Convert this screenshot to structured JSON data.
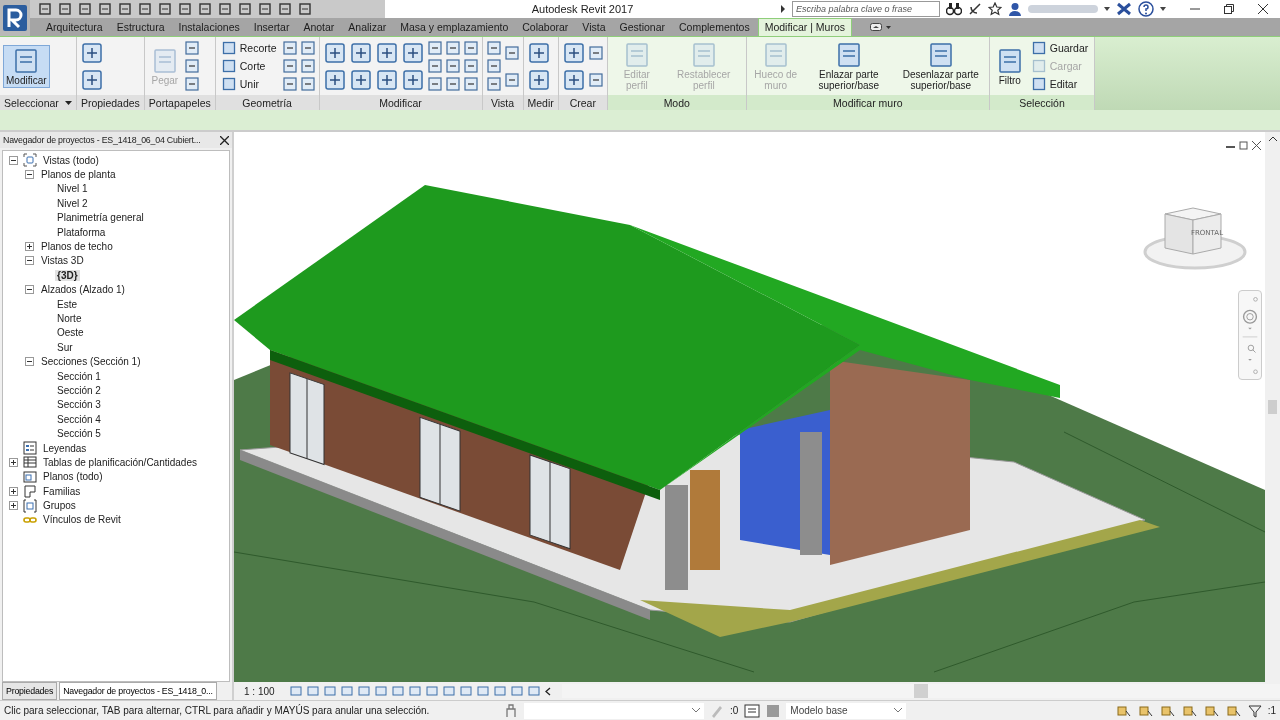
{
  "window": {
    "title": "Autodesk Revit 2017"
  },
  "search": {
    "placeholder": "Escriba palabra clave o frase"
  },
  "ribbon_tabs": [
    {
      "label": "Arquitectura",
      "selected": false
    },
    {
      "label": "Estructura",
      "selected": false
    },
    {
      "label": "Instalaciones",
      "selected": false
    },
    {
      "label": "Insertar",
      "selected": false
    },
    {
      "label": "Anotar",
      "selected": false
    },
    {
      "label": "Analizar",
      "selected": false
    },
    {
      "label": "Masa y emplazamiento",
      "selected": false
    },
    {
      "label": "Colaborar",
      "selected": false
    },
    {
      "label": "Vista",
      "selected": false
    },
    {
      "label": "Gestionar",
      "selected": false
    },
    {
      "label": "Complementos",
      "selected": false
    },
    {
      "label": "Modificar | Muros",
      "selected": true
    }
  ],
  "ribbon_panels": [
    {
      "label": "Seleccionar",
      "dropdown": true,
      "contextual": false,
      "columns": [
        [
          {
            "kind": "large",
            "label": "Modificar",
            "active": true,
            "disabled": false
          }
        ]
      ]
    },
    {
      "label": "Propiedades",
      "dropdown": false,
      "contextual": false,
      "columns": [
        [
          {
            "kind": "bigicon"
          },
          {
            "kind": "bigicon"
          }
        ]
      ]
    },
    {
      "label": "Portapapeles",
      "dropdown": false,
      "contextual": false,
      "columns": [
        [
          {
            "kind": "large",
            "label": "Pegar",
            "active": false,
            "disabled": true
          }
        ],
        [
          {
            "kind": "icon"
          },
          {
            "kind": "icon"
          },
          {
            "kind": "icon"
          }
        ]
      ]
    },
    {
      "label": "Geometría",
      "dropdown": false,
      "contextual": false,
      "columns": [
        [
          {
            "kind": "small",
            "label": "Recorte",
            "active": false,
            "disabled": false
          },
          {
            "kind": "small",
            "label": "Corte",
            "active": false,
            "disabled": false
          },
          {
            "kind": "small",
            "label": "Unir",
            "active": false,
            "disabled": false
          }
        ],
        [
          {
            "kind": "icon"
          },
          {
            "kind": "icon"
          },
          {
            "kind": "icon"
          }
        ],
        [
          {
            "kind": "icon"
          },
          {
            "kind": "icon"
          },
          {
            "kind": "icon"
          }
        ]
      ]
    },
    {
      "label": "Modificar",
      "dropdown": false,
      "contextual": false,
      "columns": [
        [
          {
            "kind": "bigicon"
          },
          {
            "kind": "bigicon"
          }
        ],
        [
          {
            "kind": "bigicon"
          },
          {
            "kind": "bigicon"
          }
        ],
        [
          {
            "kind": "bigicon"
          },
          {
            "kind": "bigicon"
          }
        ],
        [
          {
            "kind": "bigicon"
          },
          {
            "kind": "bigicon"
          }
        ],
        [
          {
            "kind": "icon"
          },
          {
            "kind": "icon"
          },
          {
            "kind": "icon"
          }
        ],
        [
          {
            "kind": "icon"
          },
          {
            "kind": "icon"
          },
          {
            "kind": "icon"
          }
        ],
        [
          {
            "kind": "icon"
          },
          {
            "kind": "icon"
          },
          {
            "kind": "icon"
          }
        ]
      ]
    },
    {
      "label": "Vista",
      "dropdown": false,
      "contextual": false,
      "columns": [
        [
          {
            "kind": "icon"
          },
          {
            "kind": "icon"
          },
          {
            "kind": "icon"
          }
        ],
        [
          {
            "kind": "icon"
          },
          {
            "kind": "icon"
          }
        ]
      ]
    },
    {
      "label": "Medir",
      "dropdown": false,
      "contextual": false,
      "columns": [
        [
          {
            "kind": "bigicon"
          },
          {
            "kind": "bigicon"
          }
        ]
      ]
    },
    {
      "label": "Crear",
      "dropdown": false,
      "contextual": false,
      "columns": [
        [
          {
            "kind": "bigicon"
          },
          {
            "kind": "bigicon"
          }
        ],
        [
          {
            "kind": "icon"
          },
          {
            "kind": "icon"
          }
        ]
      ]
    },
    {
      "label": "Modo",
      "dropdown": false,
      "contextual": true,
      "columns": [
        [
          {
            "kind": "large",
            "label": "Editar perfil",
            "active": false,
            "disabled": true
          }
        ],
        [
          {
            "kind": "large",
            "label": "Restablecer perfil",
            "active": false,
            "disabled": true
          }
        ]
      ]
    },
    {
      "label": "Modificar muro",
      "dropdown": false,
      "contextual": true,
      "columns": [
        [
          {
            "kind": "large",
            "label": "Hueco de muro",
            "active": false,
            "disabled": true
          }
        ],
        [
          {
            "kind": "large",
            "label": "Enlazar parte superior/base",
            "active": false,
            "disabled": false
          }
        ],
        [
          {
            "kind": "large",
            "label": "Desenlazar parte superior/base",
            "active": false,
            "disabled": false
          }
        ]
      ]
    },
    {
      "label": "Selección",
      "dropdown": false,
      "contextual": true,
      "columns": [
        [
          {
            "kind": "large",
            "label": "Filtro",
            "active": false,
            "disabled": false
          }
        ],
        [
          {
            "kind": "small",
            "label": "Guardar",
            "active": false,
            "disabled": false
          },
          {
            "kind": "small",
            "label": "Cargar",
            "active": false,
            "disabled": true
          },
          {
            "kind": "small",
            "label": "Editar",
            "active": false,
            "disabled": false
          }
        ]
      ]
    }
  ],
  "project_browser": {
    "title": "Navegador de proyectos - ES_1418_06_04 Cubiert...",
    "tree": [
      {
        "kind": "views",
        "label": "Vistas (todo)",
        "expanded": true,
        "selected": false,
        "children": [
          {
            "label": "Planos de planta",
            "expanded": true,
            "selected": false,
            "children": [
              {
                "label": "Nivel 1",
                "selected": false
              },
              {
                "label": "Nivel 2",
                "selected": false
              },
              {
                "label": "Planimetría general",
                "selected": false
              },
              {
                "label": "Plataforma",
                "selected": false
              }
            ]
          },
          {
            "label": "Planos de techo",
            "expanded": false,
            "selected": false
          },
          {
            "label": "Vistas 3D",
            "expanded": true,
            "selected": false,
            "children": [
              {
                "label": "{3D}",
                "selected": true
              }
            ]
          },
          {
            "label": "Alzados (Alzado 1)",
            "expanded": true,
            "selected": false,
            "children": [
              {
                "label": "Este",
                "selected": false
              },
              {
                "label": "Norte",
                "selected": false
              },
              {
                "label": "Oeste",
                "selected": false
              },
              {
                "label": "Sur",
                "selected": false
              }
            ]
          },
          {
            "label": "Secciones (Sección 1)",
            "expanded": true,
            "selected": false,
            "children": [
              {
                "label": "Sección 1",
                "selected": false
              },
              {
                "label": "Sección 2",
                "selected": false
              },
              {
                "label": "Sección 3",
                "selected": false
              },
              {
                "label": "Sección 4",
                "selected": false
              },
              {
                "label": "Sección 5",
                "selected": false
              }
            ]
          }
        ]
      },
      {
        "kind": "legend",
        "label": "Leyendas",
        "selected": false
      },
      {
        "kind": "schedule",
        "label": "Tablas de planificación/Cantidades",
        "expanded": false,
        "selected": false
      },
      {
        "kind": "sheets",
        "label": "Planos (todo)",
        "selected": false
      },
      {
        "kind": "families",
        "label": "Familias",
        "expanded": false,
        "selected": false
      },
      {
        "kind": "groups",
        "label": "Grupos",
        "expanded": false,
        "selected": false
      },
      {
        "kind": "links",
        "label": "Vínculos de Revit",
        "selected": false
      }
    ]
  },
  "viewport": {
    "viewcube_label": "FRONTAL"
  },
  "panel_tabs": [
    {
      "label": "Propiedades",
      "selected": false
    },
    {
      "label": "Navegador de proyectos - ES_1418_0...",
      "selected": true
    }
  ],
  "view_control_bar": {
    "scale": "1 : 100"
  },
  "status_bar": {
    "message": "Clic para seleccionar, TAB para alternar, CTRL para añadir y MAYÚS para anular una selección.",
    "design_option_count": ":0",
    "model": "Modelo base",
    "filter_count": ":1"
  }
}
